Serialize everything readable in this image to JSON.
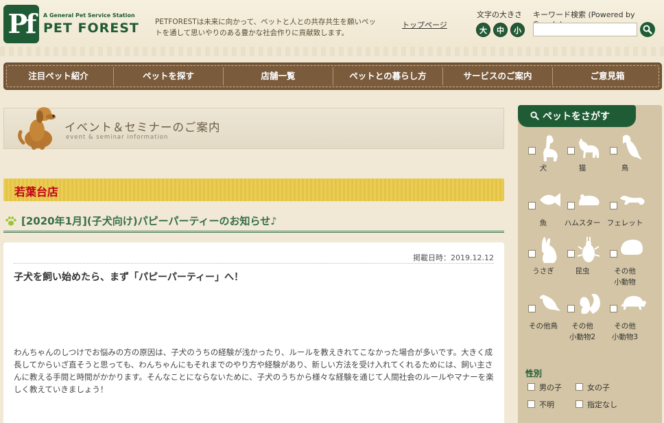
{
  "header": {
    "logo_mark": "Pf",
    "logo_sub": "A General Pet Service Station",
    "logo_main": "PET FOREST",
    "tagline": "PETFORESTは未来に向かって、ペットと人との共存共生を願いペットを通して思いやりのある豊かな社会作りに貢献致します。",
    "top_link": "トップページ",
    "font_size_label": "文字の大きさ",
    "font_sizes": [
      "大",
      "中",
      "小"
    ],
    "search_label": "キーワード検索 (Powered by Google)",
    "search_value": "",
    "brand_color": "#1f5b34"
  },
  "nav": {
    "items": [
      "注目ペット紹介",
      "ペットを探す",
      "店舗一覧",
      "ペットとの暮らし方",
      "サービスのご案内",
      "ご意見箱"
    ]
  },
  "banner": {
    "title": "イベント＆セミナーのご案内",
    "subtitle": "event & seminar information"
  },
  "store": {
    "name": "若葉台店"
  },
  "article": {
    "title": "[2020年1月](子犬向け)パピーパーティーのお知らせ♪",
    "date": "掲載日時：2019.12.12",
    "lead": "子犬を飼い始めたら、まず「パピーパーティー」へ！",
    "body": "わんちゃんのしつけでお悩みの方の原因は、子犬のうちの経験が浅かったり、ルールを教えきれてこなかった場合が多いです。大きく成長してからいざ直そうと思っても、わんちゃんにもそれまでのやり方や経験があり、新しい方法を受け入れてくれるためには、飼い主さんに教える手間と時間がかかります。そんなことにならないために、子犬のうちから様々な経験を通じて人間社会のルールやマナーを楽しく教えていきましょう！"
  },
  "sidebar": {
    "title": "ペットをさがす",
    "pets": [
      {
        "label": "犬",
        "icon": "dog-icon"
      },
      {
        "label": "猫",
        "icon": "cat-icon"
      },
      {
        "label": "鳥",
        "icon": "bird-icon"
      },
      {
        "label": "魚",
        "icon": "fish-icon"
      },
      {
        "label": "ハムスター",
        "icon": "hamster-icon"
      },
      {
        "label": "フェレット",
        "icon": "ferret-icon"
      },
      {
        "label": "うさぎ",
        "icon": "rabbit-icon"
      },
      {
        "label": "昆虫",
        "icon": "beetle-icon"
      },
      {
        "label": "その他\n小動物",
        "icon": "small-animal-icon"
      },
      {
        "label": "その他鳥",
        "icon": "other-bird-icon"
      },
      {
        "label": "その他\n小動物2",
        "icon": "squirrel-icon"
      },
      {
        "label": "その他\n小動物3",
        "icon": "turtle-icon"
      }
    ],
    "gender_title": "性別",
    "gender_options": [
      "男の子",
      "女の子",
      "不明",
      "指定なし"
    ]
  }
}
